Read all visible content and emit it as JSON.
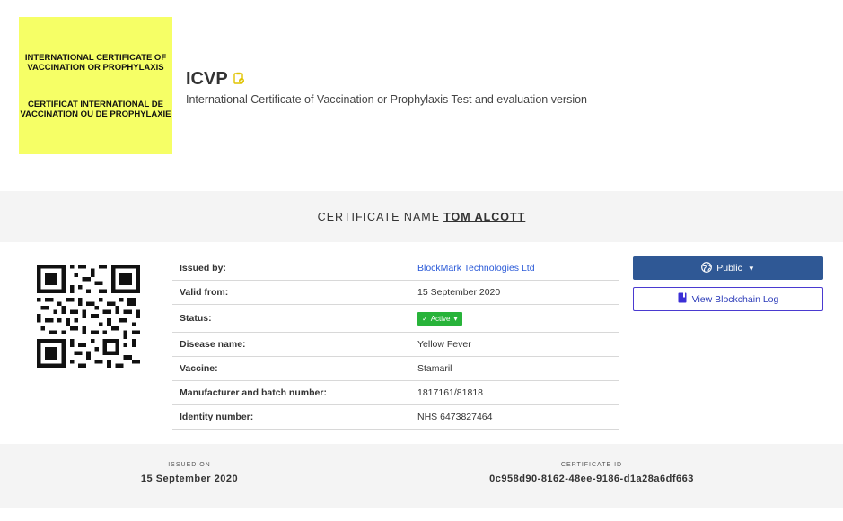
{
  "logo": {
    "line1": "INTERNATIONAL CERTIFICATE OF VACCINATION OR PROPHYLAXIS",
    "line2": "CERTIFICAT INTERNATIONAL DE VACCINATION OU DE PROPHYLAXIE",
    "background": "#f6ff66"
  },
  "header": {
    "title": "ICVP",
    "title_icon": "clipboard-badge-icon",
    "subtitle": "International Certificate of Vaccination or Prophylaxis Test and evaluation version"
  },
  "certificate": {
    "name_label": "CERTIFICATE NAME",
    "name_value": "TOM ALCOTT"
  },
  "details": [
    {
      "key": "Issued by:",
      "value": "BlockMark Technologies Ltd"
    },
    {
      "key": "Valid from:",
      "value": "15 September 2020"
    },
    {
      "key": "Status:",
      "value": "Active"
    },
    {
      "key": "Disease name:",
      "value": "Yellow Fever"
    },
    {
      "key": "Vaccine:",
      "value": "Stamaril"
    },
    {
      "key": "Manufacturer and batch number:",
      "value": "1817161/81818"
    },
    {
      "key": "Identity number:",
      "value": "NHS 6473827464"
    }
  ],
  "actions": {
    "public_label": "Public",
    "public_icon": "globe-icon",
    "log_label": "View Blockchain Log",
    "log_icon": "book-icon"
  },
  "footer": {
    "issued_on_label": "ISSUED ON",
    "issued_on_value": "15 September 2020",
    "cert_id_label": "CERTIFICATE ID",
    "cert_id_value": "0c958d90-8162-48ee-9186-d1a28a6df663"
  },
  "colors": {
    "primary": "#2f5895",
    "status_active": "#28b33a",
    "link": "#2a5ad8"
  }
}
